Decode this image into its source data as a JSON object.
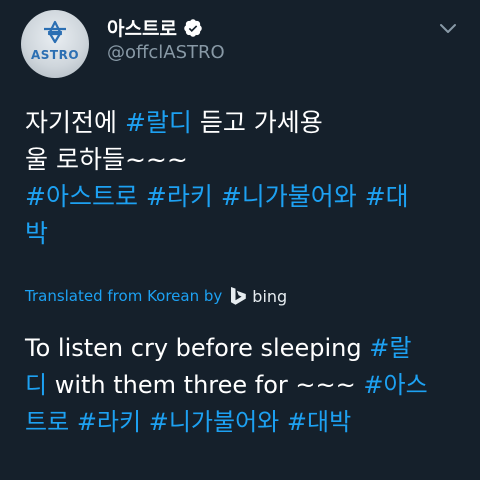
{
  "tweet": {
    "display_name": "아스트로",
    "handle": "@offclASTRO",
    "avatar_text": "ASTRO",
    "verified_icon": "verified-badge-icon",
    "menu_icon": "chevron-down-icon",
    "text_lines": [
      [
        {
          "t": "자기전에 ",
          "tag": false
        },
        {
          "t": "#랄디",
          "tag": true
        },
        {
          "t": " 듣고 가세용",
          "tag": false
        }
      ],
      [
        {
          "t": "울 로하들~~~",
          "tag": false
        }
      ],
      [
        {
          "t": "#아스트로",
          "tag": true
        },
        {
          "t": " ",
          "tag": false
        },
        {
          "t": "#라키",
          "tag": true
        },
        {
          "t": " ",
          "tag": false
        },
        {
          "t": "#니가불어와",
          "tag": true
        },
        {
          "t": " ",
          "tag": false
        },
        {
          "t": "#대",
          "tag": true
        }
      ],
      [
        {
          "t": "박",
          "tag": true
        }
      ]
    ],
    "translated_from": "Translated from Korean by",
    "translator_name": "bing",
    "translation_lines": [
      [
        {
          "t": "To listen cry before sleeping ",
          "tag": false
        },
        {
          "t": "#랄",
          "tag": true
        }
      ],
      [
        {
          "t": "디",
          "tag": true
        },
        {
          "t": " with them three for ~~~ ",
          "tag": false
        },
        {
          "t": "#아스",
          "tag": true
        }
      ],
      [
        {
          "t": "트로",
          "tag": true
        },
        {
          "t": " ",
          "tag": false
        },
        {
          "t": "#라키",
          "tag": true
        },
        {
          "t": " ",
          "tag": false
        },
        {
          "t": "#니가불어와",
          "tag": true
        },
        {
          "t": " ",
          "tag": false
        },
        {
          "t": "#대박",
          "tag": true
        }
      ]
    ]
  },
  "colors": {
    "background": "#15202b",
    "link": "#1da1f2",
    "secondary_text": "#8899a6",
    "primary_text": "#ffffff"
  }
}
